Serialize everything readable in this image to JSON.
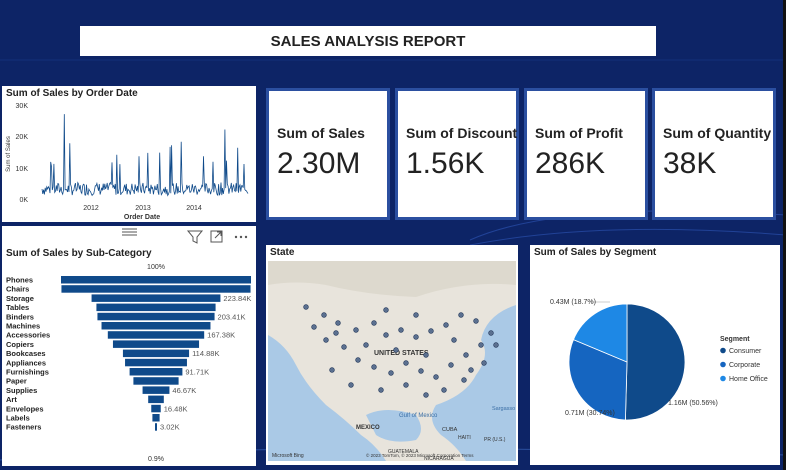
{
  "report_title": "SALES ANALYSIS REPORT",
  "kpis": [
    {
      "label": "Sum of Sales",
      "value": "2.30M"
    },
    {
      "label": "Sum of Discount",
      "value": "1.56K"
    },
    {
      "label": "Sum of Profit",
      "value": "286K"
    },
    {
      "label": "Sum of Quantity",
      "value": "38K"
    }
  ],
  "line_chart": {
    "title": "Sum of Sales by Order Date",
    "ylabel": "Sum of Sales",
    "xlabel": "Order Date",
    "y_ticks": [
      "30K",
      "20K",
      "10K",
      "0K"
    ],
    "x_ticks": [
      "2012",
      "2013",
      "2014"
    ]
  },
  "subcategory": {
    "title": "Sum of Sales by Sub-Category",
    "top_pct": "100%",
    "bottom_pct": "0.9%",
    "toolbar_icons": [
      "drag-handle-icon",
      "filter-icon",
      "focus-mode-icon",
      "more-options-icon"
    ]
  },
  "map": {
    "title": "State",
    "labels": {
      "us": "UNITED STATES",
      "mexico": "MEXICO",
      "gulf": "Gulf of\nMexico",
      "cuba": "CUBA",
      "sargasso": "Sargasso",
      "haiti": "HAITI",
      "pr": "PR\n(U.S.)",
      "guatemala": "GUATEMALA",
      "nicaragua": "NICARAGUA"
    },
    "attribution": "Microsoft Bing",
    "copyright": "© 2023 TomTom, © 2023 Microsoft Corporation  Terms"
  },
  "pie": {
    "title": "Sum of Sales by Segment",
    "legend_title": "Segment",
    "labels": [
      "1.16M\n(50.56%)",
      "0.71M\n(30.74%)",
      "0.43M (18.7%)"
    ]
  },
  "chart_data": [
    {
      "type": "line",
      "title": "Sum of Sales by Order Date",
      "xlabel": "Order Date",
      "ylabel": "Sum of Sales",
      "ylim": [
        0,
        30000
      ],
      "x_ticks": [
        "2012",
        "2013",
        "2014"
      ],
      "notable_peaks": [
        {
          "x": "2011-03",
          "y": 28000
        },
        {
          "x": "2014-03",
          "y": 23000
        },
        {
          "x": "2013-10",
          "y": 19000
        }
      ],
      "baseline_typical": 3000
    },
    {
      "type": "bar",
      "title": "Sum of Sales by Sub-Category",
      "categories": [
        "Phones",
        "Chairs",
        "Storage",
        "Tables",
        "Binders",
        "Machines",
        "Accessories",
        "Copiers",
        "Bookcases",
        "Appliances",
        "Furnishings",
        "Paper",
        "Supplies",
        "Art",
        "Envelopes",
        "Labels",
        "Fasteners"
      ],
      "values": [
        330010,
        328450,
        223840,
        206970,
        203410,
        189240,
        167380,
        149530,
        114880,
        107530,
        91710,
        78480,
        46670,
        27120,
        16480,
        12490,
        3020
      ],
      "data_labels": {
        "Storage": "223.84K",
        "Binders": "203.41K",
        "Accessories": "167.38K",
        "Bookcases": "114.88K",
        "Furnishings": "91.71K",
        "Supplies": "46.67K",
        "Envelopes": "16.48K",
        "Fasteners": "3.02K"
      }
    },
    {
      "type": "pie",
      "title": "Sum of Sales by Segment",
      "series": [
        {
          "name": "Consumer",
          "value": 1.16,
          "pct": 50.56,
          "color": "#0f4a8a"
        },
        {
          "name": "Corporate",
          "value": 0.71,
          "pct": 30.74,
          "color": "#1565c0"
        },
        {
          "name": "Home Office",
          "value": 0.43,
          "pct": 18.7,
          "color": "#1e88e5"
        }
      ],
      "legend": "right"
    }
  ]
}
